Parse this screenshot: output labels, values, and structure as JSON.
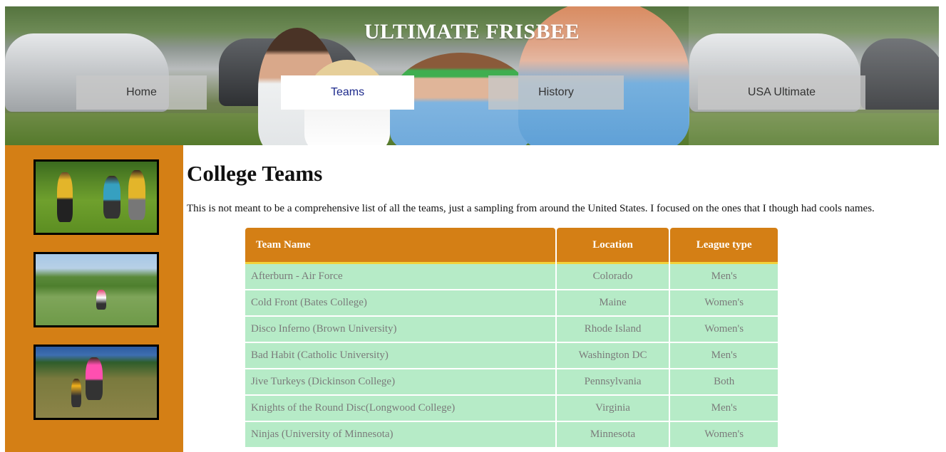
{
  "header": {
    "title": "ULTIMATE FRISBEE",
    "nav": [
      {
        "label": "Home"
      },
      {
        "label": "Teams"
      },
      {
        "label": "History"
      },
      {
        "label": "USA Ultimate"
      }
    ]
  },
  "main": {
    "title": "College Teams",
    "intro": "This is not meant to be a comprehensive list of all the teams, just a sampling from around the United States. I focused on the ones that I though had cools names.",
    "table": {
      "headers": [
        "Team Name",
        "Location",
        "League type"
      ],
      "rows": [
        [
          "Afterburn - Air Force",
          "Colorado",
          "Men's"
        ],
        [
          "Cold Front (Bates College)",
          "Maine",
          "Women's"
        ],
        [
          "Disco Inferno (Brown University)",
          "Rhode Island",
          "Women's"
        ],
        [
          "Bad Habit (Catholic University)",
          "Washington DC",
          "Men's"
        ],
        [
          "Jive Turkeys (Dickinson College)",
          "Pennsylvania",
          "Both"
        ],
        [
          "Knights of the Round Disc(Longwood College)",
          "Virginia",
          "Men's"
        ],
        [
          "Ninjas (University of Minnesota)",
          "Minnesota",
          "Women's"
        ]
      ]
    }
  },
  "colors": {
    "accent": "#d47f15",
    "row_bg": "#b6ebc7",
    "header_underline": "#f2d23a",
    "active_nav_text": "#1d2a8c"
  }
}
